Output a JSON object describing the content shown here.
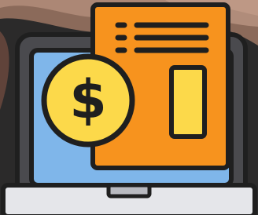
{
  "illustration": {
    "icon": "online-invoice-payment-icon",
    "currency_symbol": "$"
  },
  "colors": {
    "outline": "#1f1f1f",
    "laptop_frame": "#4a4a4e",
    "screen": "#7fb6ea",
    "document": "#f7931e",
    "coin": "#fcd94a",
    "base": "#e5e6ea",
    "base_shadow": "#b9bac0",
    "background_warm": "#8b6a5a",
    "background_dark": "#2b2a2a"
  }
}
